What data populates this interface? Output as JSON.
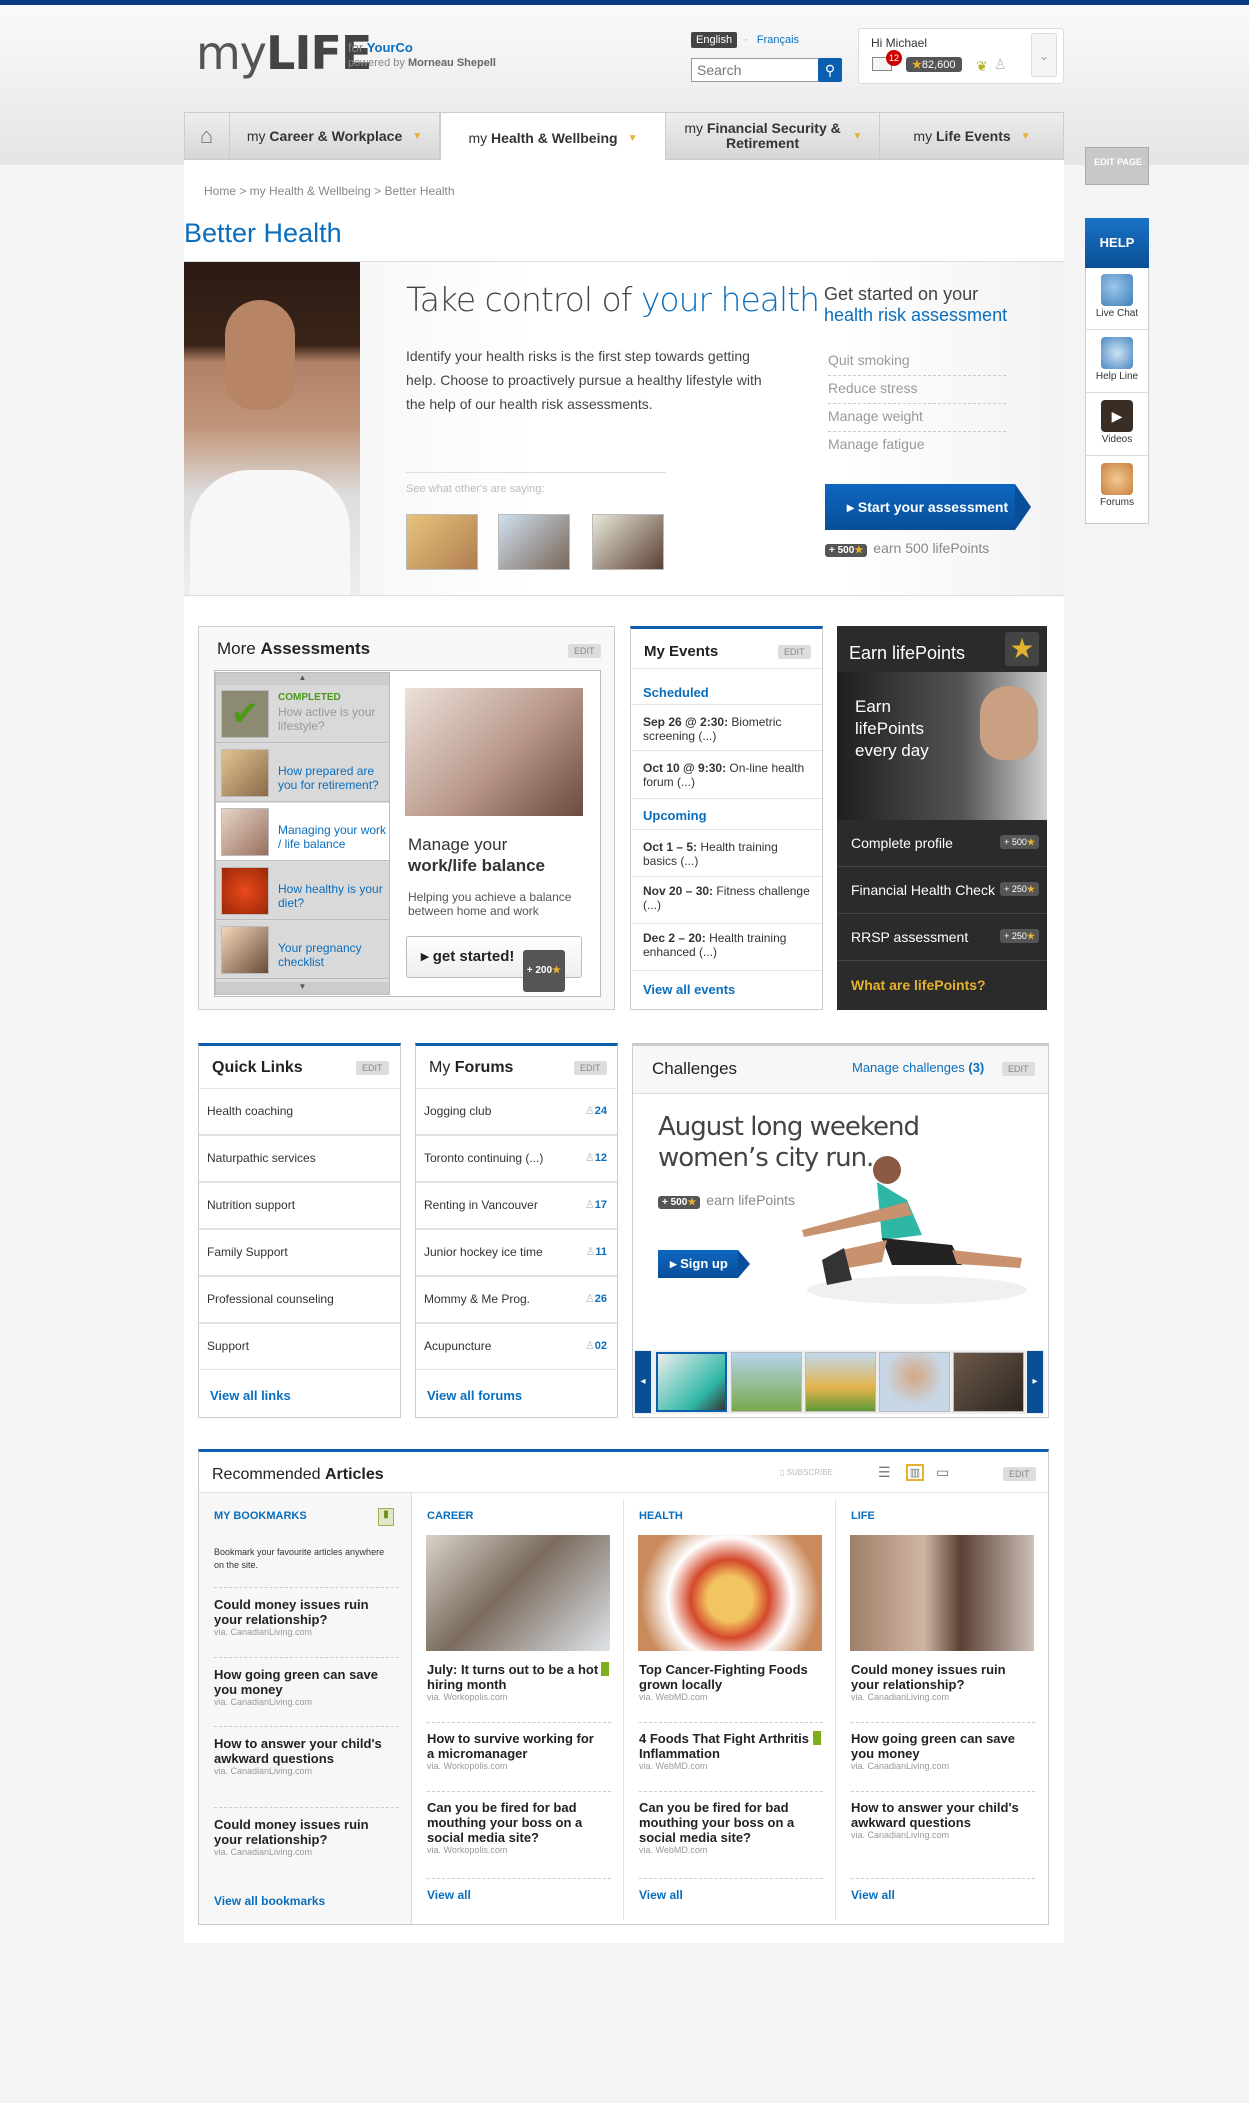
{
  "header": {
    "logo_my": "my",
    "logo_life": "LIFE",
    "for": "for",
    "company": "YourCo",
    "powered_by": "powered by",
    "powered_company": "Morneau Shepell",
    "lang_en": "English",
    "lang_fr": "Français",
    "search_placeholder": "Search",
    "greeting": "Hi Michael",
    "messages": "12",
    "points": "82,600"
  },
  "nav": [
    {
      "pre": "my",
      "label": "Career & Workplace"
    },
    {
      "pre": "my",
      "label": "Health & Wellbeing"
    },
    {
      "pre": "my",
      "label": "Financial Security & Retirement"
    },
    {
      "pre": "my",
      "label": "Life Events"
    }
  ],
  "breadcrumb": "Home > my Health & Wellbeing > Better Health",
  "page_title": "Better Health",
  "hero": {
    "title_a": "Take control of",
    "title_b": "your health",
    "text": "Identify your health risks is the first step towards getting help. Choose to proactively pursue a healthy lifestyle with the help of our health risk assessments.",
    "see": "See what other's are saying:",
    "assess_title_a": "Get started on your",
    "assess_title_b": "health risk assessment",
    "risks": [
      "Quit smoking",
      "Reduce stress",
      "Manage weight",
      "Manage fatigue"
    ],
    "start_btn": "Start your assessment",
    "points": "+ 500",
    "earn": "earn 500 lifePoints"
  },
  "sidebar": {
    "edit": "EDIT PAGE",
    "help": "HELP",
    "items": [
      "Live Chat",
      "Help Line",
      "Videos",
      "Forums"
    ]
  },
  "more_assessments": {
    "title_a": "More",
    "title_b": "Assessments",
    "edit": "EDIT",
    "completed": "COMPLETED",
    "items": [
      "How active is your lifestyle?",
      "How prepared are you for retirement?",
      "Managing your work / life balance",
      "How healthy is your diet?",
      "Your pregnancy checklist"
    ],
    "feature_a": "Manage your",
    "feature_b": "work/life balance",
    "feature_sub": "Helping you achieve a balance between home and work",
    "get_started": "get started!",
    "points": "+ 200"
  },
  "events": {
    "title": "My Events",
    "edit": "EDIT",
    "scheduled": "Scheduled",
    "s1_date": "Sep 26 @ 2:30:",
    "s1_text": "Biometric screening (...)",
    "s2_date": "Oct 10 @ 9:30:",
    "s2_text": "On-line health forum (...)",
    "upcoming": "Upcoming",
    "u1_date": "Oct 1 – 5:",
    "u1_text": "Health training basics (...)",
    "u2_date": "Nov 20 – 30:",
    "u2_text": "Fitness challenge (...)",
    "u3_date": "Dec 2 – 20:",
    "u3_text": "Health training enhanced (...)",
    "view_all": "View all events"
  },
  "lifepoints": {
    "title": "Earn lifePoints",
    "promo": "Earn lifePoints every day",
    "items": [
      {
        "label": "Complete profile",
        "points": "+ 500"
      },
      {
        "label": "Financial Health Check",
        "points": "+ 250"
      },
      {
        "label": "RRSP assessment",
        "points": "+ 250"
      }
    ],
    "what": "What are lifePoints?"
  },
  "quick_links": {
    "title": "Quick Links",
    "edit": "EDIT",
    "items": [
      "Health coaching",
      "Naturpathic services",
      "Nutrition support",
      "Family Support",
      "Professional counseling",
      "Support"
    ],
    "view_all": "View all links"
  },
  "forums": {
    "title_a": "My",
    "title_b": "Forums",
    "edit": "EDIT",
    "items": [
      {
        "label": "Jogging club",
        "count": "24"
      },
      {
        "label": "Toronto continuing (...)",
        "count": "12"
      },
      {
        "label": "Renting in Vancouver",
        "count": "17"
      },
      {
        "label": "Junior hockey ice time",
        "count": "11"
      },
      {
        "label": "Mommy & Me Prog.",
        "count": "26"
      },
      {
        "label": "Acupuncture",
        "count": "02"
      }
    ],
    "view_all": "View all forums"
  },
  "challenges": {
    "title": "Challenges",
    "manage": "Manage challenges",
    "manage_count": "(3)",
    "edit": "EDIT",
    "feature_a": "August long weekend",
    "feature_b": "women’s city run.",
    "points": "+ 500",
    "earn": "earn lifePoints",
    "signup": "Sign up"
  },
  "articles": {
    "title_a": "Recommended",
    "title_b": "Articles",
    "subscribe": "SUBSCRIBE",
    "edit": "EDIT",
    "bookmarks": {
      "head": "MY BOOKMARKS",
      "intro": "Bookmark your favourite articles anywhere on the site.",
      "items": [
        {
          "title": "Could money issues ruin your relationship?",
          "via": "via. CanadianLiving.com"
        },
        {
          "title": "How going green can save you money",
          "via": "via. CanadianLiving.com"
        },
        {
          "title": "How to answer your child's awkward questions",
          "via": "via. CanadianLiving.com"
        },
        {
          "title": "Could money issues ruin your relationship?",
          "via": "via. CanadianLiving.com"
        }
      ],
      "view_all": "View all bookmarks"
    },
    "career": {
      "head": "CAREER",
      "items": [
        {
          "title": "July: It turns out to be a hot hiring month",
          "via": "via. Workopolis.com"
        },
        {
          "title": "How to survive working for a micromanager",
          "via": "via. Workopolis.com"
        },
        {
          "title": "Can you be fired for bad mouthing your boss on a social media site?",
          "via": "via. Workopolis.com"
        }
      ],
      "view_all": "View all"
    },
    "health": {
      "head": "HEALTH",
      "items": [
        {
          "title": "Top Cancer-Fighting Foods grown locally",
          "via": "via. WebMD.com"
        },
        {
          "title": "4 Foods That Fight Arthritis Inflammation",
          "via": "via. WebMD.com"
        },
        {
          "title": "Can you be fired for bad mouthing your boss on a social media site?",
          "via": "via. WebMD.com"
        }
      ],
      "view_all": "View all"
    },
    "life": {
      "head": "LIFE",
      "items": [
        {
          "title": "Could money issues ruin your relationship?",
          "via": "via. CanadianLiving.com"
        },
        {
          "title": "How going green can save you money",
          "via": "via. CanadianLiving.com"
        },
        {
          "title": "How to answer your child's awkward questions",
          "via": "via. CanadianLiving.com"
        }
      ],
      "view_all": "View all"
    }
  }
}
